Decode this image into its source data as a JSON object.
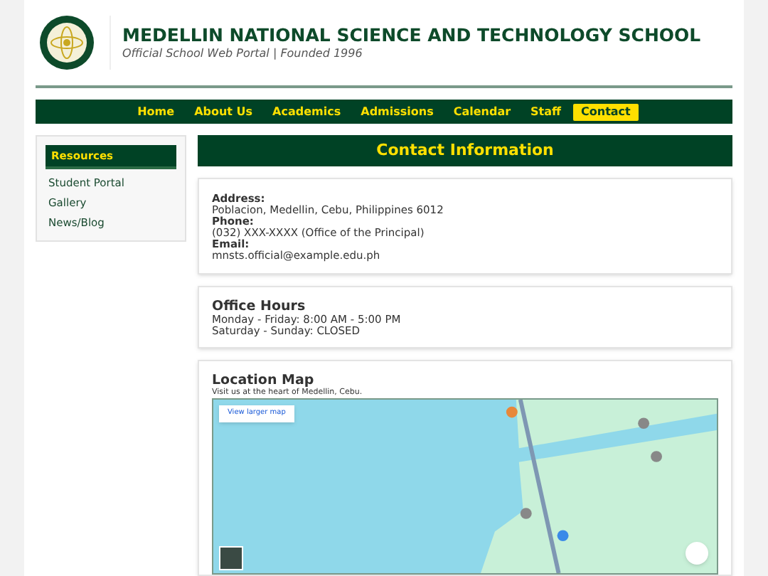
{
  "header": {
    "title": "MEDELLIN NATIONAL SCIENCE AND TECHNOLOGY SCHOOL",
    "subtitle": "Official School Web Portal | Founded 1996"
  },
  "nav": [
    {
      "label": "Home",
      "selected": false
    },
    {
      "label": "About Us",
      "selected": false
    },
    {
      "label": "Academics",
      "selected": false
    },
    {
      "label": "Admissions",
      "selected": false
    },
    {
      "label": "Calendar",
      "selected": false
    },
    {
      "label": "Staff",
      "selected": false
    },
    {
      "label": "Contact",
      "selected": true
    }
  ],
  "sidebar": {
    "heading": "Resources",
    "items": [
      "Student Portal",
      "Gallery",
      "News/Blog"
    ]
  },
  "page_title": "Contact Information",
  "contact": [
    {
      "label": "Address:",
      "value": "Poblacion, Medellin, Cebu, Philippines 6012"
    },
    {
      "label": "Phone:",
      "value": "(032) XXX-XXXX (Office of the Principal)"
    },
    {
      "label": "Email:",
      "value": "mnsts.official@example.edu.ph"
    }
  ],
  "office_hours": {
    "title": "Office Hours",
    "lines": [
      "Monday - Friday: 8:00 AM - 5:00 PM",
      "Saturday - Sunday: CLOSED"
    ]
  },
  "map": {
    "title": "Location Map",
    "caption": "Visit us at the heart of Medellin, Cebu.",
    "button": "View larger map"
  }
}
